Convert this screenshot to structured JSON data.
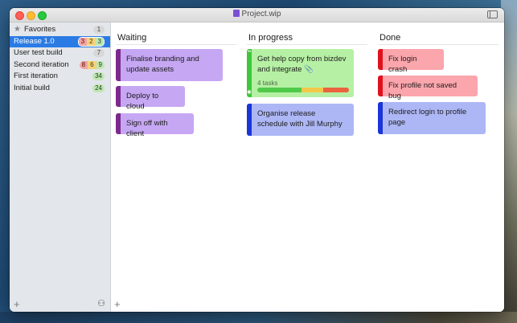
{
  "window": {
    "title": "Project.wip"
  },
  "sidebar": {
    "favorites": {
      "label": "Favorites",
      "count": "1"
    },
    "items": [
      {
        "label": "Release 1.0",
        "counts": [
          "3",
          "2",
          "3"
        ],
        "selected": true
      },
      {
        "label": "User test build",
        "count": "7"
      },
      {
        "label": "Second iteration",
        "counts": [
          "8",
          "6",
          "9"
        ]
      },
      {
        "label": "First iteration",
        "count": "34"
      },
      {
        "label": "Initial build",
        "count": "24"
      }
    ],
    "add_symbol": "+",
    "person_icon": "person-icon"
  },
  "board": {
    "columns": [
      {
        "title": "Waiting",
        "cards": [
          {
            "text": "Finalise branding and update assets"
          },
          {
            "text": "Deploy to cloud"
          },
          {
            "text": "Sign off with client"
          }
        ]
      },
      {
        "title": "In progress",
        "cards": [
          {
            "text": "Get help copy from bizdev and integrate",
            "tasks": "4 tasks",
            "progress": [
              0.48,
              0.24,
              0.28
            ]
          },
          {
            "text": "Organise release schedule with Jill Murphy"
          }
        ]
      },
      {
        "title": "Done",
        "cards": [
          {
            "text": "Fix login crash"
          },
          {
            "text": "Fix profile not saved bug"
          },
          {
            "text": "Redirect login to profile page"
          }
        ]
      }
    ],
    "add_symbol": "+"
  },
  "colors": {
    "waiting_strip": "#7b2a8c",
    "waiting_card": "#c6a7f3",
    "progress_strip": "#40c63a",
    "progress_card": "#b6f0a4",
    "blue_strip": "#1b35d8",
    "blue_card": "#adb7f5",
    "done_strip": "#e0111b",
    "done_card": "#fba5ac",
    "selection": "#2a7be4"
  }
}
